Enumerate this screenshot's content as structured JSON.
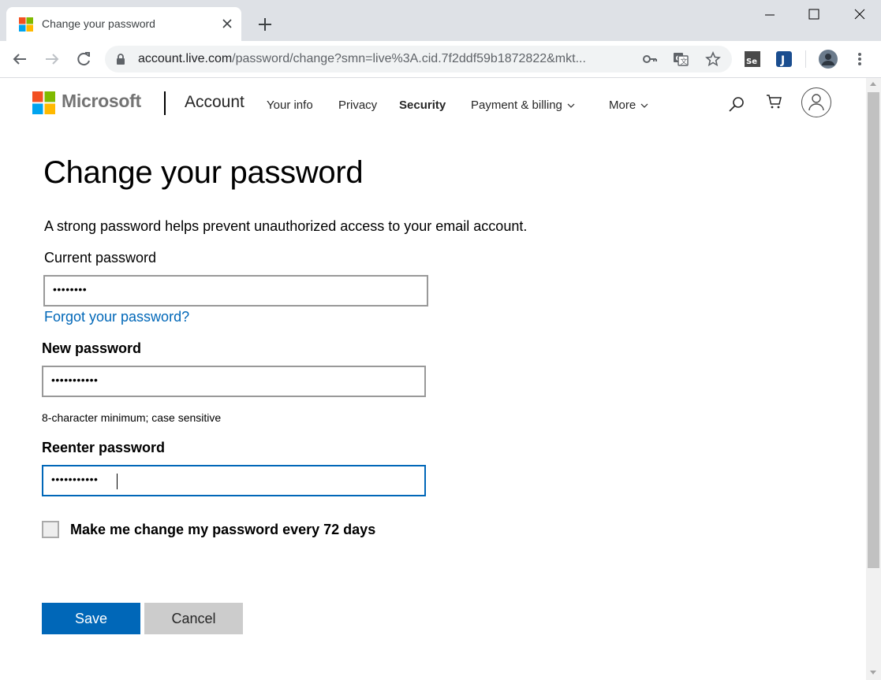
{
  "browser": {
    "tab": {
      "title": "Change your password"
    },
    "url": {
      "host": "account.live.com",
      "path": "/password/change?smn=live%3A.cid.7f2ddf59b1872822&mkt..."
    },
    "extensions": [
      "key-icon",
      "translate-icon",
      "star-icon",
      "selenium-extension-icon",
      "extension-j-icon",
      "profile-avatar",
      "kebab-menu-icon"
    ]
  },
  "header": {
    "brand": "Microsoft",
    "section": "Account",
    "nav": {
      "your_info": "Your info",
      "privacy": "Privacy",
      "security": "Security",
      "payment": "Payment & billing",
      "more": "More"
    }
  },
  "form": {
    "title": "Change your password",
    "intro": "A strong password helps prevent unauthorized access to your email account.",
    "current_label": "Current password",
    "current_value": "••••••••",
    "forgot_link": "Forgot your password?",
    "new_label": "New password",
    "new_value": "•••••••••••",
    "hint": "8-character minimum; case sensitive",
    "reenter_label": "Reenter password",
    "reenter_value": "•••••••••••",
    "checkbox_label": "Make me change my password every 72 days",
    "checkbox_checked": false,
    "save": "Save",
    "cancel": "Cancel"
  },
  "colors": {
    "accent": "#0067b8",
    "cancel_bg": "#cccccc",
    "ms_red": "#f25022",
    "ms_green": "#7fba00",
    "ms_blue": "#00a4ef",
    "ms_yellow": "#ffb900"
  }
}
